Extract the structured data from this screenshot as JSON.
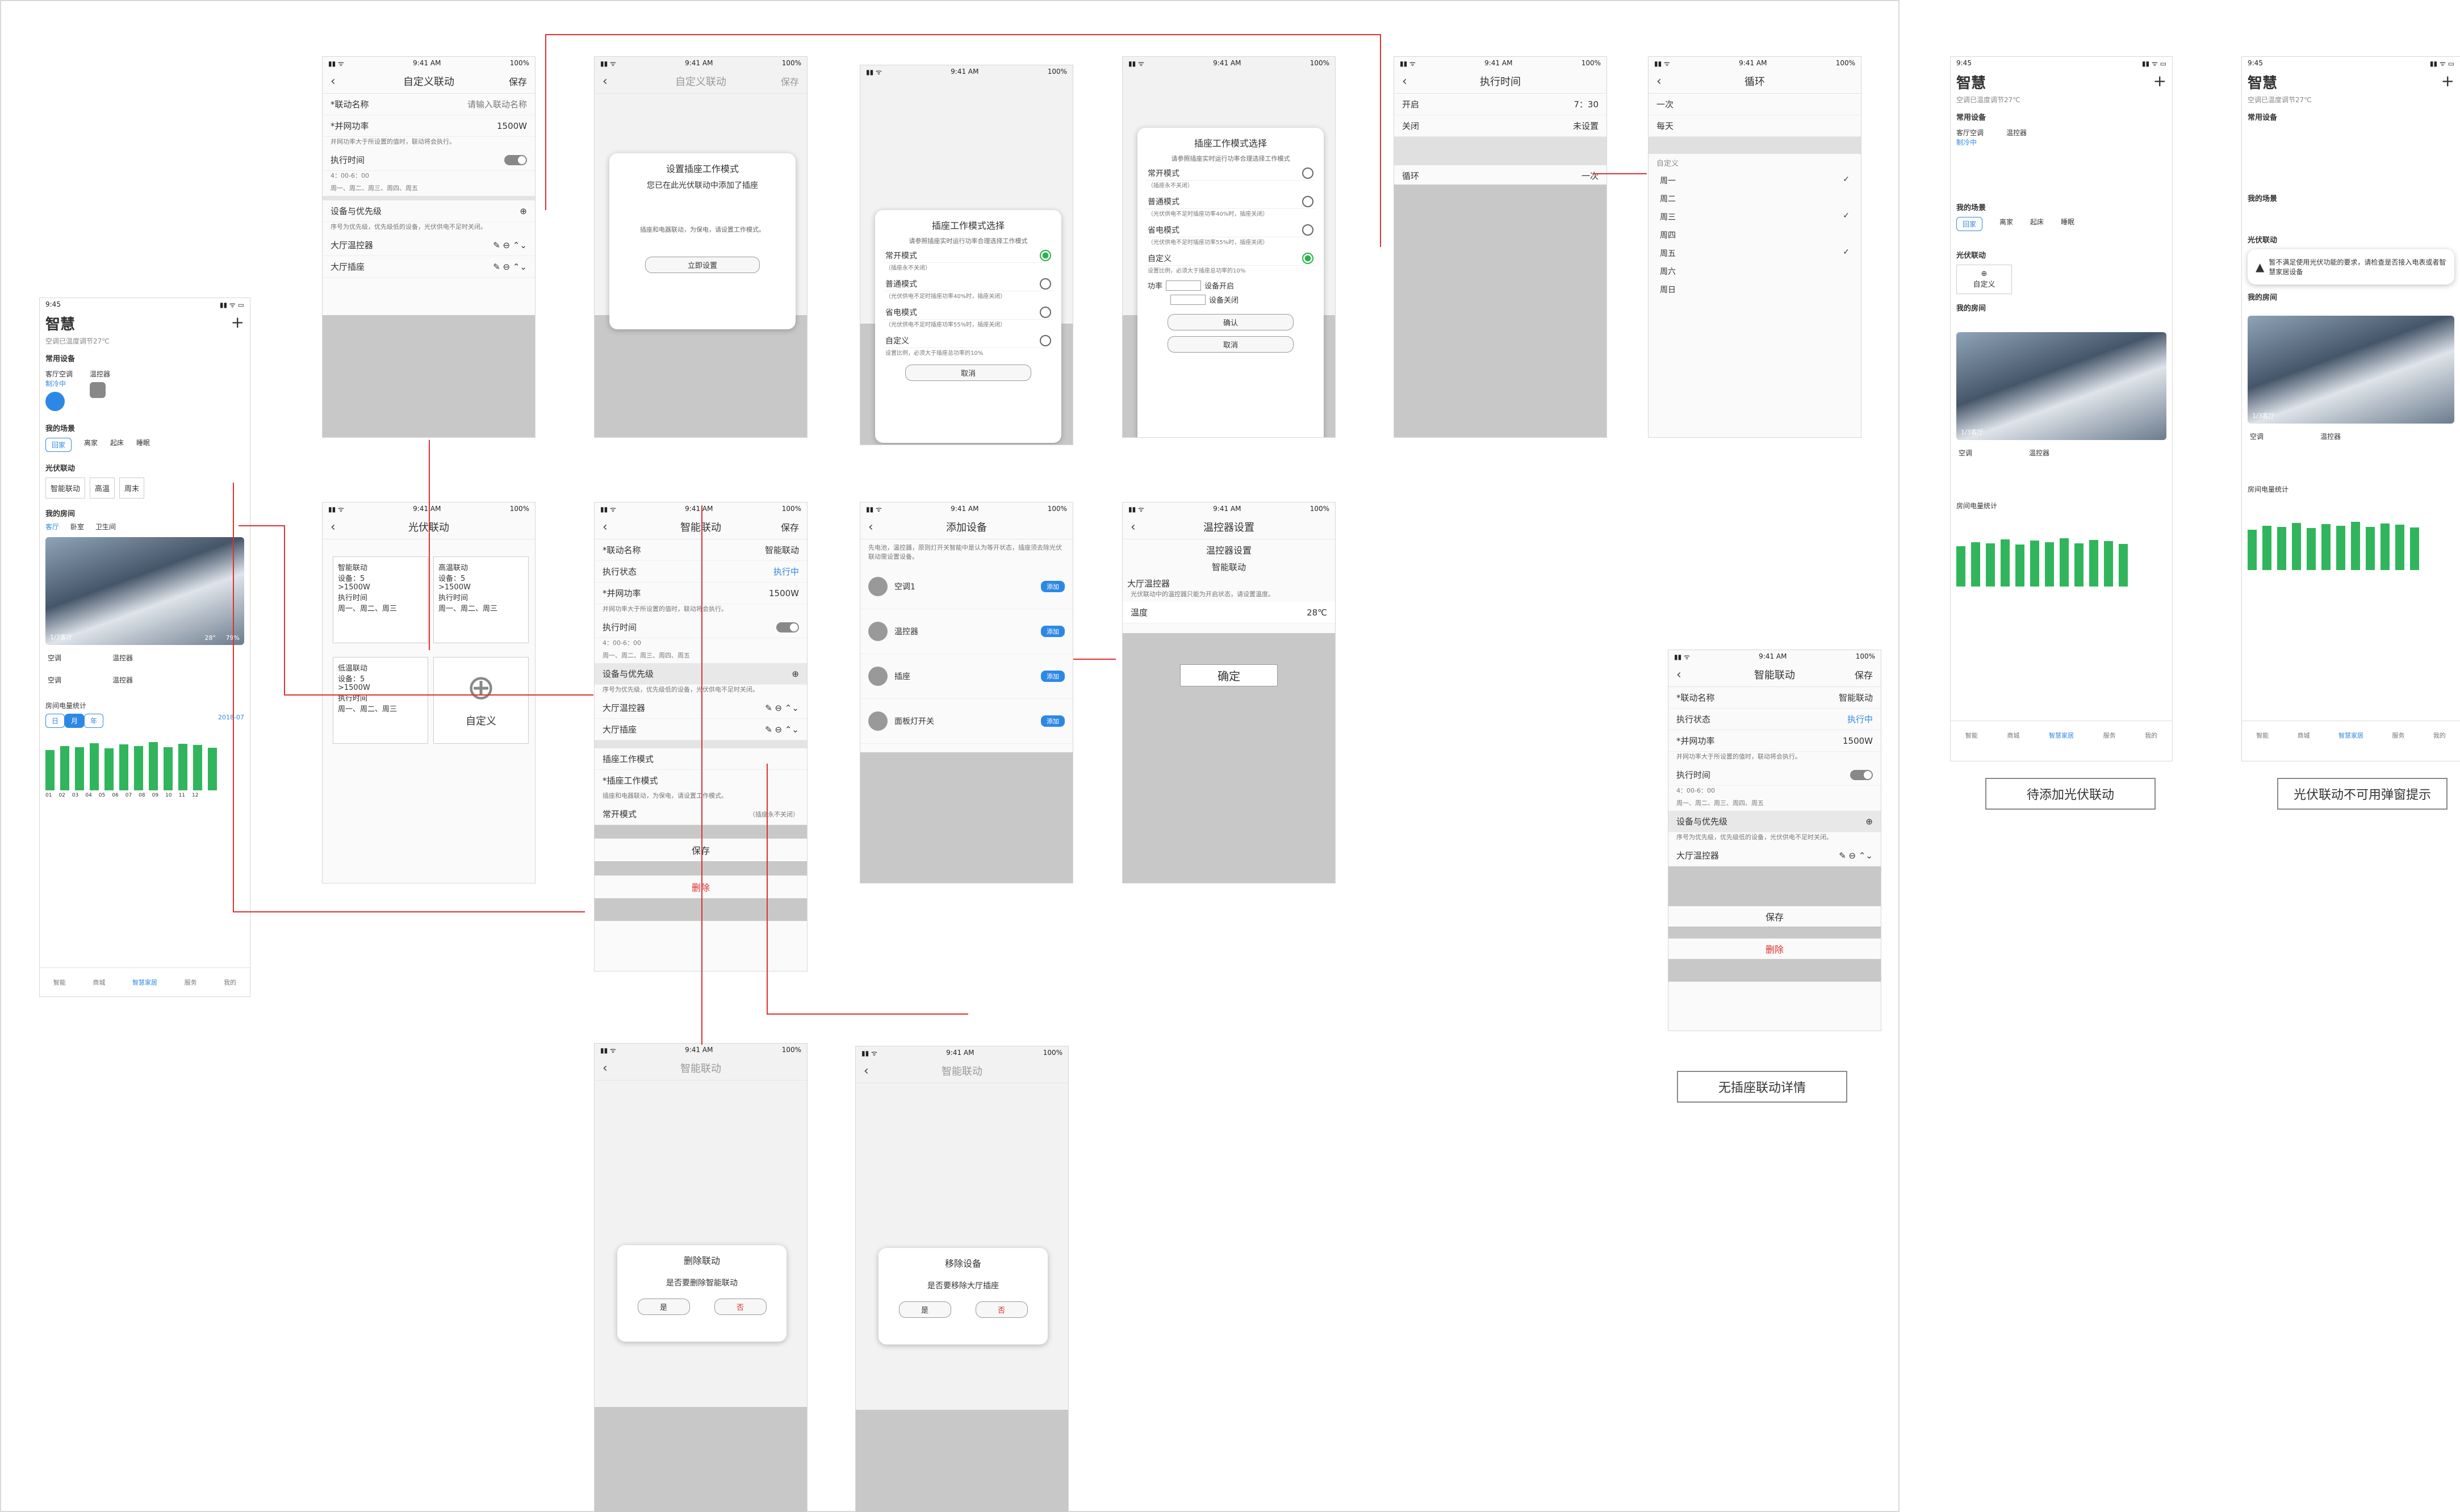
{
  "status": {
    "time": "9:41 AM",
    "battery": "100%",
    "time_short": "9:45"
  },
  "home": {
    "title": "智慧",
    "search_hint": "空调已温度调节27℃",
    "common_devices": "常用设备",
    "device_ac": "客厅空调",
    "device_ac_state": "制冷中",
    "device_thermo": "温控器",
    "my_scenes": "我的场景",
    "scenes": [
      "回家",
      "离家",
      "起床",
      "睡眠"
    ],
    "pv_link": "光伏联动",
    "pv_chips": [
      "智能联动",
      "高温",
      "周末"
    ],
    "my_rooms": "我的房间",
    "room_tabs": [
      "客厅",
      "卧室",
      "卫生间"
    ],
    "room_label": "1/3客厅",
    "room_temp": "28°",
    "room_hum": "79%",
    "ac": "空调",
    "thermo": "温控器",
    "power_stats": "房间电量统计",
    "period_tabs": [
      "日",
      "月",
      "年"
    ],
    "period_value": "2018-07",
    "months": [
      "01",
      "02",
      "03",
      "04",
      "05",
      "06",
      "07",
      "08",
      "09",
      "10",
      "11",
      "12"
    ],
    "bar_values": [
      65,
      72,
      70,
      76,
      68,
      74,
      72,
      78,
      70,
      75,
      73,
      69
    ],
    "tabs": [
      "智能",
      "商城",
      "智慧家居",
      "服务",
      "我的"
    ],
    "add_scene": "自定义",
    "alert": "暂不满足使用光伏功能的要求，请检查是否接入电表或者智慧家居设备"
  },
  "custom_link": {
    "title": "自定义联动",
    "save": "保存",
    "name_label": "*联动名称",
    "name_placeholder": "请输入联动名称",
    "power_label": "*并网功率",
    "power_value": "1500W",
    "power_hint": "并网功率大于所设置的值时，联动将会执行。",
    "time_label": "执行时间",
    "time_range": "4：00-6：00",
    "time_days": "周一、周二、周三、周四、周五",
    "devices_label": "设备与优先级",
    "devices_hint": "序号为优先级，优先级低的设备，光伏供电不足时关闭。",
    "device_1": "大厅温控器",
    "device_2": "大厅插座"
  },
  "socket_modal": {
    "title": "设置插座工作模式",
    "body": "您已在此光伏联动中添加了插座",
    "hint": "插座和电器联动，为保电，请设置工作模式。",
    "button": "立即设置"
  },
  "mode_select": {
    "title": "插座工作模式选择",
    "subtitle": "请参照插座实时运行功率合理选择工作模式",
    "options": [
      {
        "name": "常开模式",
        "desc": "（插座永不关闭）"
      },
      {
        "name": "普通模式",
        "desc": "（光伏供电不足时插座功率40%时，插座关闭）"
      },
      {
        "name": "省电模式",
        "desc": "（光伏供电不足时插座功率55%时，插座关闭）"
      },
      {
        "name": "自定义",
        "desc": "设置比例，必须大于插座总功率的10%"
      }
    ],
    "cancel": "取消",
    "confirm": "确认",
    "power": "功率",
    "device_on": "设备开启",
    "device_off": "设备关闭"
  },
  "exec_time": {
    "title": "执行时间",
    "start": "开启",
    "start_value": "7：30",
    "end": "关闭",
    "end_value": "未设置",
    "loop": "循环",
    "loop_value": "一次"
  },
  "loop": {
    "title": "循环",
    "options": [
      "一次",
      "每天"
    ],
    "custom": "自定义",
    "days": [
      "周一",
      "周二",
      "周三",
      "周四",
      "周五",
      "周六",
      "周日"
    ]
  },
  "pv_link": {
    "title": "光伏联动",
    "cards": [
      {
        "name": "智能联动",
        "device": "设备：5",
        "power": ">1500W",
        "time": "执行时间",
        "days": "周一、周二、周三"
      },
      {
        "name": "高温联动",
        "device": "设备：5",
        "power": ">1500W",
        "time": "执行时间",
        "days": "周一、周二、周三"
      },
      {
        "name": "低温联动",
        "device": "设备：5",
        "power": ">1500W",
        "time": "执行时间",
        "days": "周一、周二、周三"
      }
    ],
    "add": "自定义"
  },
  "smart_link": {
    "title": "智能联动",
    "name_value": "智能联动",
    "status_label": "执行状态",
    "status_value": "执行中",
    "socket_mode": "插座工作模式",
    "socket_mode_label": "*插座工作模式",
    "socket_hint": "插座和电器联动，为保电，请设置工作模式。",
    "socket_mode_value": "常开模式",
    "socket_mode_desc": "（插座永不关闭）",
    "delete": "删除"
  },
  "add_device": {
    "title": "添加设备",
    "hint": "先电池，温控器，原则灯开关智能中是认为等开状态，插座须去除光伏联动需设置设备。",
    "items": [
      "空调1",
      "温控器",
      "插座",
      "面板灯开关"
    ],
    "add": "添加"
  },
  "thermo_setting": {
    "title": "温控器设置",
    "subtitle": "温控器设置",
    "link_name": "智能联动",
    "device": "大厅温控器",
    "device_hint": "光伏联动中的温控器只能为开启状态，请设置温度。",
    "temp_label": "温度",
    "temp_value": "28℃",
    "ok": "确定"
  },
  "delete_link": {
    "title": "删除联动",
    "body": "是否要删除智能联动",
    "yes": "是",
    "no": "否"
  },
  "remove_device": {
    "title": "移除设备",
    "body": "是否要移除大厅插座",
    "yes": "是",
    "no": "否"
  },
  "captions": {
    "no_socket": "无插座联动详情",
    "pending": "待添加光伏联动",
    "unavailable": "光伏联动不可用弹窗提示"
  }
}
